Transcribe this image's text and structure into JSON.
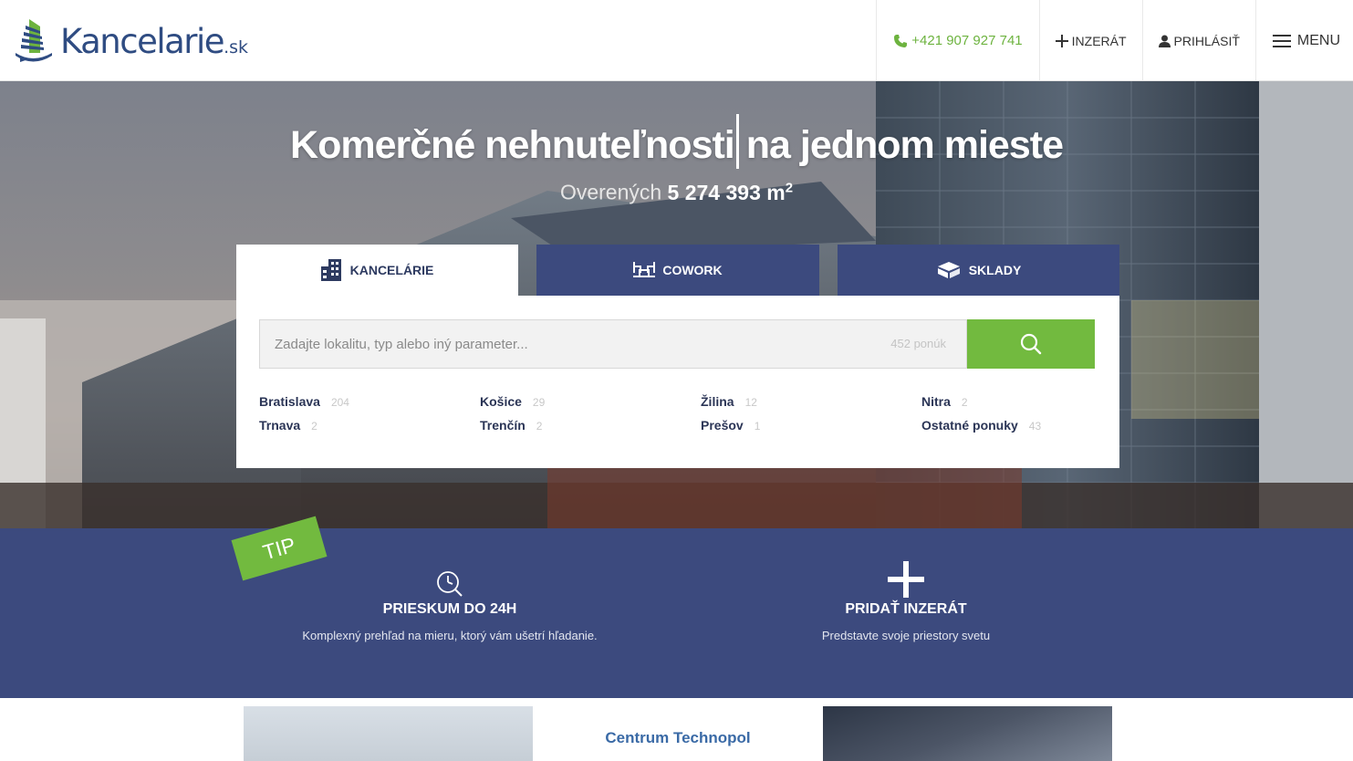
{
  "header": {
    "logo_text": "Kancelarie",
    "logo_tld": ".sk",
    "phone": "+421 907 927 741",
    "nav": {
      "add_listing": "Inzerát",
      "login": "Prihlásiť",
      "menu": "Menu"
    }
  },
  "hero": {
    "title_part1": "Komerčné nehnuteľnosti",
    "title_part2": "na jednom mieste",
    "subtitle_prefix": "Overených",
    "subtitle_value": "5 274 393 m",
    "subtitle_sup": "2"
  },
  "search": {
    "tabs": [
      {
        "label": "Kancelárie",
        "icon": "building-icon",
        "active": true
      },
      {
        "label": "Cowork",
        "icon": "desk-icon",
        "active": false
      },
      {
        "label": "Sklady",
        "icon": "boxes-icon",
        "active": false
      }
    ],
    "placeholder": "Zadajte lokalitu, typ alebo iný parameter...",
    "offer_count": "452 ponúk",
    "button_icon": "search-icon",
    "cities": [
      {
        "name": "Bratislava",
        "count": "204"
      },
      {
        "name": "Košice",
        "count": "29"
      },
      {
        "name": "Žilina",
        "count": "12"
      },
      {
        "name": "Nitra",
        "count": "2"
      },
      {
        "name": "Trnava",
        "count": "2"
      },
      {
        "name": "Trenčín",
        "count": "2"
      },
      {
        "name": "Prešov",
        "count": "1"
      },
      {
        "name": "Ostatné ponuky",
        "count": "43"
      }
    ]
  },
  "band": {
    "tip": "TIP",
    "features": [
      {
        "title": "Prieskum do 24h",
        "desc": "Komplexný prehľad na mieru, ktorý vám ušetrí hľadanie.",
        "icon": "clock-search-icon"
      },
      {
        "title": "Pridať inzerát",
        "desc": "Predstavte svoje priestory svetu",
        "icon": "plus-icon"
      }
    ]
  },
  "listing": {
    "title": "Centrum Technopol"
  },
  "colors": {
    "navy": "#3c4a7e",
    "green": "#72ba3f",
    "logo_blue": "#2f4c82"
  }
}
